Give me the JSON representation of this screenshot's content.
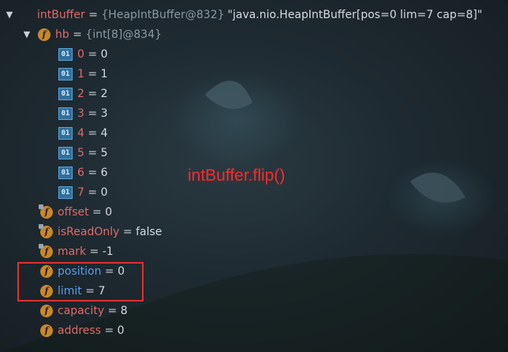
{
  "root": {
    "name": "intBuffer",
    "type": "{HeapIntBuffer@832}",
    "string": "\"java.nio.HeapIntBuffer[pos=0 lim=7 cap=8]\""
  },
  "hb": {
    "name": "hb",
    "type": "{int[8]@834}"
  },
  "elements": [
    {
      "index": "0",
      "value": "0"
    },
    {
      "index": "1",
      "value": "1"
    },
    {
      "index": "2",
      "value": "2"
    },
    {
      "index": "3",
      "value": "3"
    },
    {
      "index": "4",
      "value": "4"
    },
    {
      "index": "5",
      "value": "5"
    },
    {
      "index": "6",
      "value": "6"
    },
    {
      "index": "7",
      "value": "0"
    }
  ],
  "fields": [
    {
      "name": "offset",
      "value": "0"
    },
    {
      "name": "isReadOnly",
      "value": "false"
    },
    {
      "name": "mark",
      "value": "-1"
    },
    {
      "name": "position",
      "value": "0"
    },
    {
      "name": "limit",
      "value": "7"
    },
    {
      "name": "capacity",
      "value": "8"
    },
    {
      "name": "address",
      "value": "0"
    }
  ],
  "annotation": "intBuffer.flip()",
  "icons": {
    "field": "f",
    "array_element": "01",
    "object": "object-stack-icon",
    "expanded": "caret-down-icon"
  },
  "colors": {
    "field_name": "#e06a6a",
    "highlighted_field_name": "#5b9dea",
    "annotation": "#ff2a2a",
    "highlight_box": "#e03030",
    "field_icon": "#c8882a",
    "array_icon": "#2f6f9e"
  }
}
